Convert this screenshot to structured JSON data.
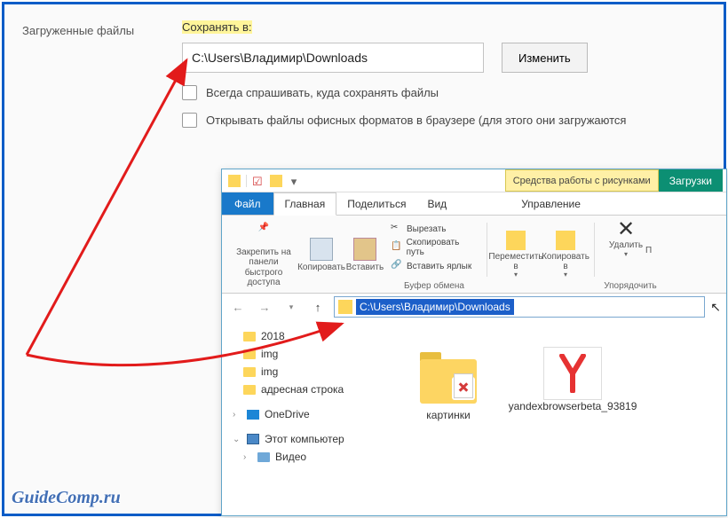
{
  "settings": {
    "section_label": "Загруженные файлы",
    "save_to_label": "Сохранять в:",
    "path_value": "C:\\Users\\Владимир\\Downloads",
    "change_btn": "Изменить",
    "check_ask": "Всегда спрашивать, куда сохранять файлы",
    "check_office": "Открывать файлы офисных форматов в браузере (для этого они загружаются"
  },
  "explorer": {
    "picture_tools": "Средства работы с рисунками",
    "downloads_tab": "Загрузки",
    "tab_file": "Файл",
    "tab_main": "Главная",
    "tab_share": "Поделиться",
    "tab_view": "Вид",
    "tab_manage": "Управление",
    "ribbon": {
      "pin": "Закрепить на панели быстрого доступа",
      "copy": "Копировать",
      "paste": "Вставить",
      "cut": "Вырезать",
      "copy_path": "Скопировать путь",
      "paste_shortcut": "Вставить ярлык",
      "clipboard_label": "Буфер обмена",
      "move_to": "Переместить в",
      "copy_to": "Копировать в",
      "delete": "Удалить",
      "rename_prefix": "П",
      "organize_label": "Упорядочить"
    },
    "address": "C:\\Users\\Владимир\\Downloads",
    "tree": {
      "f1": "2018",
      "f2": "img",
      "f3": "img",
      "f4": "адресная строка",
      "onedrive": "OneDrive",
      "thispc": "Этот компьютер",
      "videos": "Видео"
    },
    "items": {
      "pictures": "картинки",
      "yandex": "yandexbrowserbeta_93819"
    }
  },
  "watermark": "GuideComp.ru"
}
